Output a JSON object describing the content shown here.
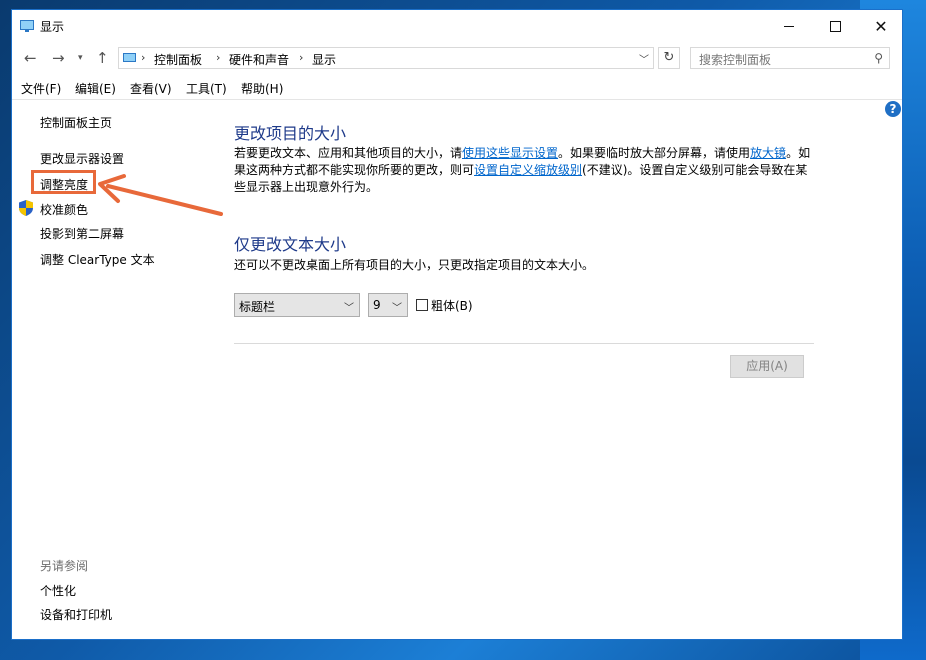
{
  "window": {
    "title": "显示"
  },
  "nav": {
    "breadcrumbs": [
      "控制面板",
      "硬件和声音",
      "显示"
    ],
    "search_placeholder": "搜索控制面板"
  },
  "menu": [
    "文件(F)",
    "编辑(E)",
    "查看(V)",
    "工具(T)",
    "帮助(H)"
  ],
  "sidebar": {
    "home": "控制面板主页",
    "links": [
      "更改显示器设置",
      "调整亮度",
      "校准颜色",
      "投影到第二屏幕",
      "调整 ClearType 文本"
    ],
    "see_also_title": "另请参阅",
    "see_also": [
      "个性化",
      "设备和打印机"
    ]
  },
  "main": {
    "section1_title": "更改项目的大小",
    "p1_a": "若要更改文本、应用和其他项目的大小，请",
    "p1_link1": "使用这些显示设置",
    "p1_b": "。如果要临时放大部分屏幕，请使用",
    "p1_link2": "放大镜",
    "p1_c": "。如果这两种方式都不能实现你所要的更改，则可",
    "p1_link3": "设置自定义缩放级别",
    "p1_d": "(不建议)。设置自定义级别可能会导致在某些显示器上出现意外行为。",
    "section2_title": "仅更改文本大小",
    "p2": "还可以不更改桌面上所有项目的大小，只更改指定项目的文本大小。",
    "item_select": "标题栏",
    "size_select": "9",
    "bold_label": "粗体(B)",
    "apply_label": "应用(A)"
  },
  "colors": {
    "highlight": "#e8693a",
    "link": "#0066cc",
    "heading": "#1e3a8a"
  }
}
